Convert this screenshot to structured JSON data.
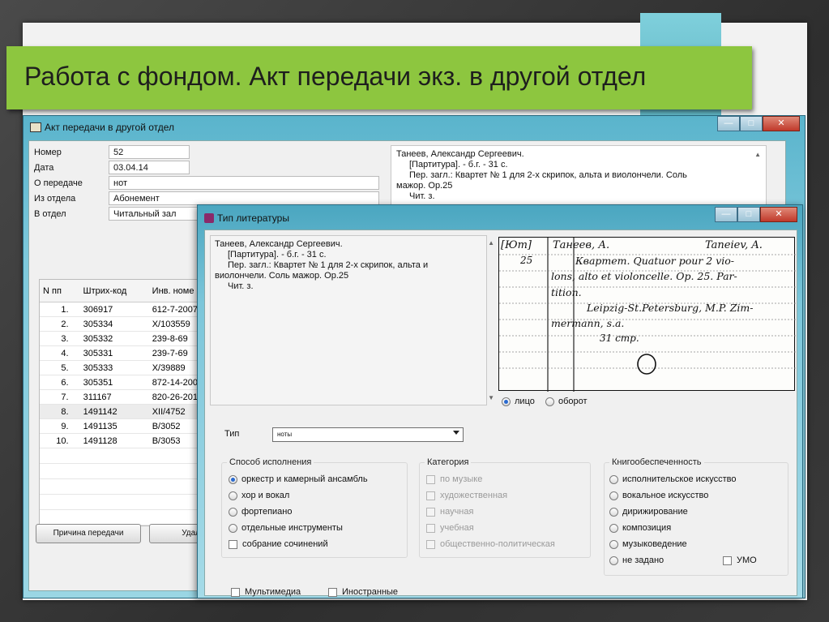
{
  "slide": {
    "title": "Работа с фондом. Акт передачи экз. в другой отдел"
  },
  "main_window": {
    "title": "Акт передачи в другой отдел",
    "fields": [
      {
        "label": "Номер",
        "value": "52"
      },
      {
        "label": "Дата",
        "value": "03.04.14"
      },
      {
        "label": "О передаче",
        "value": "нот"
      },
      {
        "label": "Из отдела",
        "value": "Абонемент"
      },
      {
        "label": "В отдел",
        "value": "Читальный зал"
      }
    ],
    "biblio": {
      "author": "Танеев, Александр Сергеевич.",
      "line1": "[Партитура]. - б.г. - 31 с.",
      "line2": "Пер. загл.: Квартет № 1 для 2-х скрипок, альта и виолончели. Соль",
      "line3": "мажор. Op.25",
      "line4": "Чит. з."
    },
    "table": {
      "columns": [
        "N пп",
        "Штрих-код",
        "Инв. номе"
      ],
      "rows": [
        {
          "n": "1.",
          "barcode": "306917",
          "inv": "612-7-2007"
        },
        {
          "n": "2.",
          "barcode": "305334",
          "inv": "X/103559"
        },
        {
          "n": "3.",
          "barcode": "305332",
          "inv": "239-8-69"
        },
        {
          "n": "4.",
          "barcode": "305331",
          "inv": "239-7-69"
        },
        {
          "n": "5.",
          "barcode": "305333",
          "inv": "X/39889"
        },
        {
          "n": "6.",
          "barcode": "305351",
          "inv": "872-14-200"
        },
        {
          "n": "7.",
          "barcode": "311167",
          "inv": "820-26-201"
        },
        {
          "n": "8.",
          "barcode": "1491142",
          "inv": "XII/4752"
        },
        {
          "n": "9.",
          "barcode": "1491135",
          "inv": "B/3052"
        },
        {
          "n": "10.",
          "barcode": "1491128",
          "inv": "B/3053"
        }
      ]
    },
    "buttons": {
      "reason": "Причина передачи",
      "delete": "Удал"
    }
  },
  "dialog": {
    "title": "Тип литературы",
    "text": {
      "author": "Танеев, Александр Сергеевич.",
      "line1": "[Партитура]. - б.г. - 31 с.",
      "line2": "Пер. загл.: Квартет № 1 для 2-х скрипок, альта и",
      "line3": "виолончели. Соль мажор. Op.25",
      "line4": "Чит. з."
    },
    "card": {
      "l1a": "[Ют]",
      "l1b": "Танеев, А.",
      "l1c": "Taneiev, A.",
      "l2a": "25",
      "l2b": "Квартет. Quatuor pour 2 vio-",
      "l3": "lons, alto et violoncelle. Op. 25. Par-",
      "l4": "tition.",
      "l5": "Leipzig-St.Petersburg, M.P. Zim-",
      "l6": "mermann, s.a.",
      "l7": "31 стр."
    },
    "side": {
      "front": "лицо",
      "back": "оборот",
      "selected": "лицо"
    },
    "type": {
      "label": "Тип",
      "value": "ноты"
    },
    "performance": {
      "title": "Способ исполнения",
      "options": [
        {
          "label": "оркестр и камерный ансамбль",
          "checked": true
        },
        {
          "label": "хор и вокал",
          "checked": false
        },
        {
          "label": "фортепиано",
          "checked": false
        },
        {
          "label": "отдельные инструменты",
          "checked": false
        }
      ],
      "collection": "собрание сочинений"
    },
    "category": {
      "title": "Категория",
      "options": [
        "по музыке",
        "художественная",
        "научная",
        "учебная",
        "общественно-политическая"
      ]
    },
    "provision": {
      "title": "Книгообеспеченность",
      "options": [
        "исполнительское искусство",
        "вокальное искусство",
        "дирижирование",
        "композиция",
        "музыковедение",
        "не задано"
      ],
      "umo": "УМО"
    },
    "multimedia": "Мультимедиа",
    "foreign": "Иностранные"
  },
  "colors": {
    "title_banner": "#8dc63f",
    "window_frame": "#5ab4cc",
    "close_button": "#c0392b"
  }
}
